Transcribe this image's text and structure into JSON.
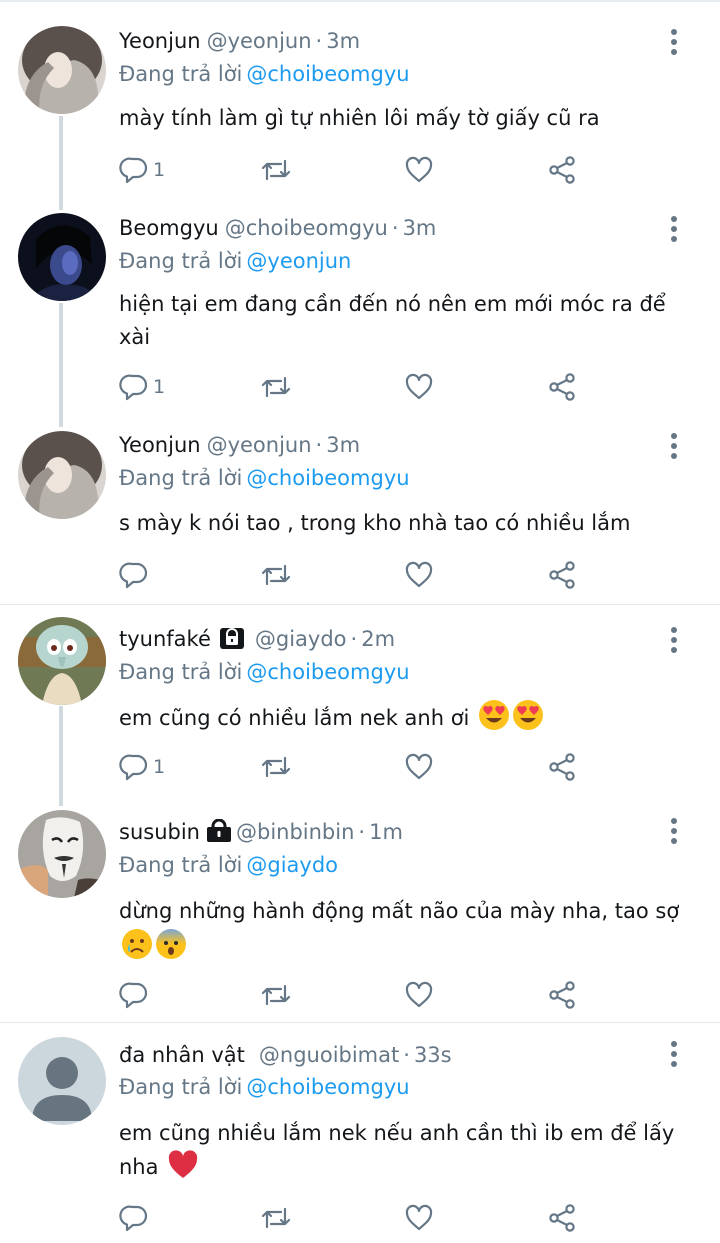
{
  "replying_label": "Đang trả lời",
  "dot": "·",
  "icons": {
    "reply": "reply-icon",
    "retweet": "retweet-icon",
    "like": "heart-icon",
    "share": "share-icon",
    "more": "more-vertical-icon",
    "lock": "lock-icon"
  },
  "colors": {
    "mention": "#1d9bf0",
    "secondary": "#657786",
    "text": "#14171a"
  },
  "tweets": [
    {
      "name": "Yeonjun",
      "handle": "@yeonjun",
      "time": "3m",
      "reply_to": "@choibeomgyu",
      "text": "mày tính làm gì tự nhiên lôi mấy tờ giấy cũ ra",
      "reply_count": "1"
    },
    {
      "name": "Beomgyu",
      "handle": "@choibeomgyu",
      "time": "3m",
      "reply_to": "@yeonjun",
      "text": "hiện tại em đang cần đến nó nên em mới móc ra để xài",
      "reply_count": "1"
    },
    {
      "name": "Yeonjun",
      "handle": "@yeonjun",
      "time": "3m",
      "reply_to": "@choibeomgyu",
      "text": "s mày k nói tao ,  trong kho nhà tao có nhiều lắm",
      "reply_count": ""
    },
    {
      "name": "tyunfaké",
      "handle": "@giaydo",
      "time": "2m",
      "reply_to": "@choibeomgyu",
      "text": "em cũng có nhiều lắm nek anh ơi ",
      "emoji": [
        "smiling-face-heart-eyes",
        "smiling-face-heart-eyes"
      ],
      "reply_count": "1"
    },
    {
      "name": "susubin",
      "handle": "@binbinbin",
      "time": "1m",
      "reply_to": "@giaydo",
      "text": "dừng những hành động mất não của mày nha,  tao sợ ",
      "emoji": [
        "crying-face",
        "fearful-face"
      ],
      "reply_count": ""
    },
    {
      "name": "đa nhân vật",
      "handle": "@nguoibimat",
      "time": "33s",
      "reply_to": "@choibeomgyu",
      "text": "em cũng nhiều lắm nek nếu anh cần thì ib em để lấy nha ",
      "emoji": [
        "red-heart"
      ],
      "reply_count": ""
    }
  ]
}
